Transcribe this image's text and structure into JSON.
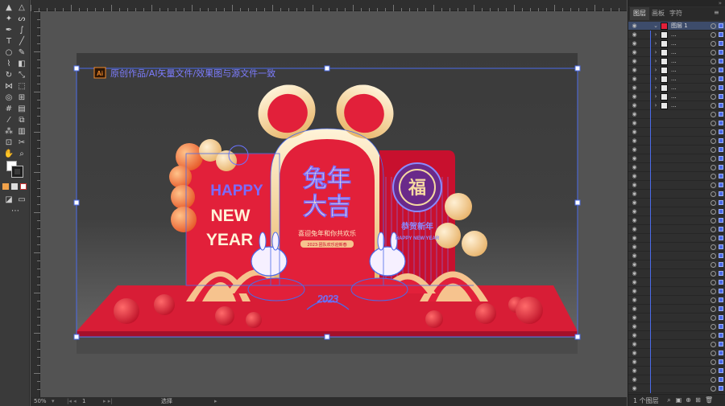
{
  "canvas": {
    "overlay_badge": "Ai",
    "overlay_text": "原创作品/AI矢量文件/效果图与源文件一致"
  },
  "artwork": {
    "left_line1": "HAPPY",
    "left_line2": "NEW",
    "left_line3": "YEAR",
    "center_title_top": "兔年",
    "center_title_bottom": "大吉",
    "center_subtitle": "喜迎兔年和你共欢乐",
    "center_tagline": "2023·团队欢乐迎新春",
    "right_emblem": "福",
    "right_line1": "恭贺新年",
    "right_line2": "HAPPY NEW YEAR",
    "bottom_year": "2023"
  },
  "status": {
    "zoom": "50%",
    "artboard_index": "1",
    "tool": "选择"
  },
  "panel": {
    "tabs": [
      "图层",
      "画板",
      "字符"
    ],
    "active_tab": 0,
    "top_layer_name": "图层 1",
    "footer_label": "1 个图层",
    "layer_placeholder": "..."
  },
  "colors": {
    "accent_red": "#e2203a",
    "selection_blue": "#4b6bea",
    "gold": "#f5d9a1"
  }
}
